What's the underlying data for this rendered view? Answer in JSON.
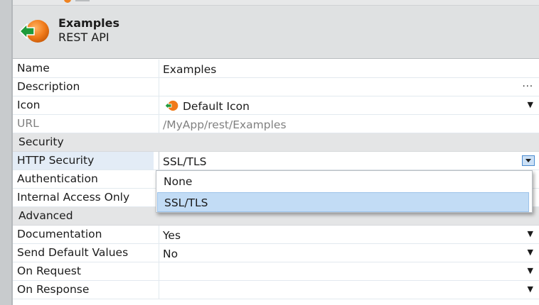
{
  "header": {
    "title": "Examples",
    "subtitle": "REST API"
  },
  "properties": {
    "name": {
      "label": "Name",
      "value": "Examples"
    },
    "description": {
      "label": "Description",
      "value": "",
      "button": "..."
    },
    "icon": {
      "label": "Icon",
      "value": "Default Icon"
    },
    "url": {
      "label": "URL",
      "value": "/MyApp/rest/Examples"
    },
    "security_section": "Security",
    "http_security": {
      "label": "HTTP Security",
      "value": "SSL/TLS"
    },
    "authentication": {
      "label": "Authentication"
    },
    "internal_access": {
      "label": "Internal Access Only"
    },
    "advanced_section": "Advanced",
    "documentation": {
      "label": "Documentation",
      "value": "Yes"
    },
    "send_default": {
      "label": "Send Default Values",
      "value": "No"
    },
    "on_request": {
      "label": "On Request",
      "value": ""
    },
    "on_response": {
      "label": "On Response",
      "value": ""
    }
  },
  "dropdown": {
    "options": [
      "None",
      "SSL/TLS"
    ],
    "selected": "SSL/TLS"
  },
  "icons": {
    "rest_api": "orange-ball-green-arrow-icon",
    "dropdown": "chevron-down-icon"
  },
  "colors": {
    "accent_orange": "#ef8220",
    "arrow_green": "#1f9a3a",
    "selection_blue": "#c2dcf5"
  }
}
